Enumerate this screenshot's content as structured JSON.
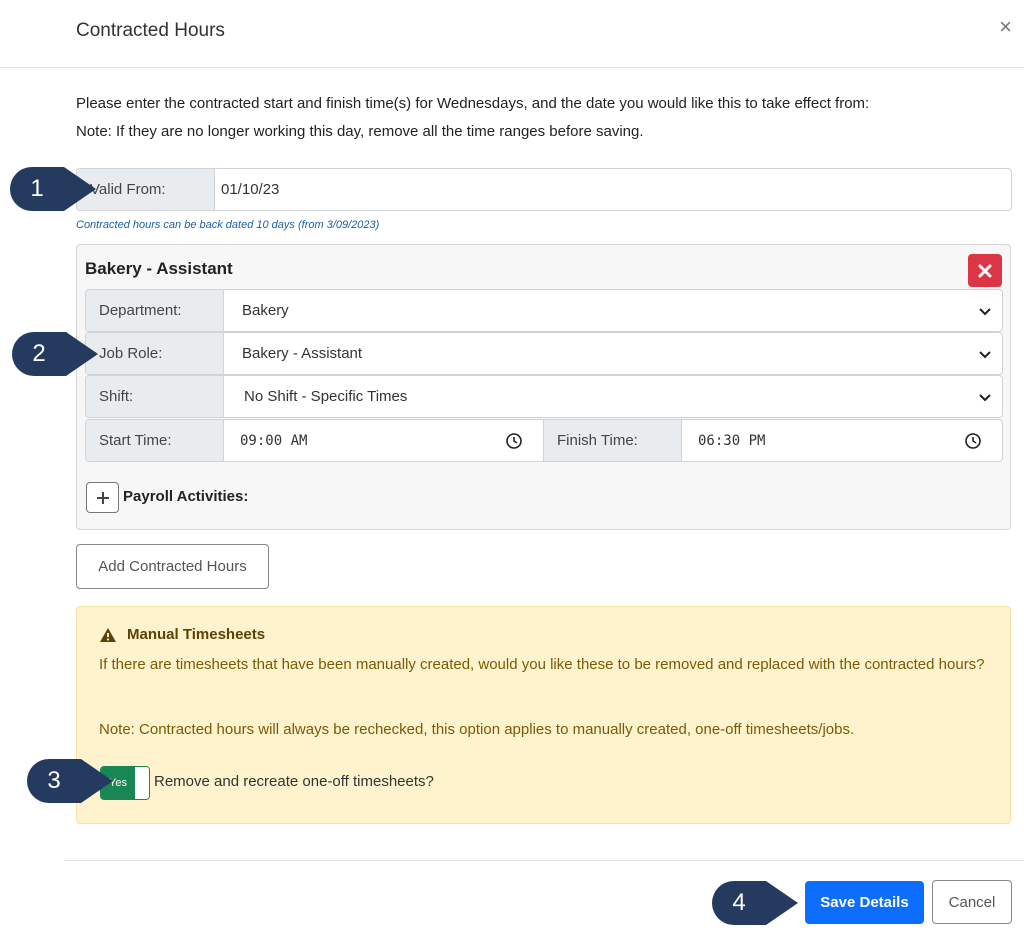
{
  "modal": {
    "title": "Contracted Hours",
    "close_glyph": "×"
  },
  "intro": {
    "line1": "Please enter the contracted start and finish time(s) for Wednesdays, and the date you would like this to take effect from:",
    "line2": "Note: If they are no longer working this day, remove all the time ranges before saving."
  },
  "valid_from": {
    "label": "Valid From:",
    "value": "01/10/23",
    "hint": "Contracted hours can be back dated 10 days (from 3/09/2023)"
  },
  "panel": {
    "title": "Bakery - Assistant",
    "delete_icon": "x-icon",
    "department": {
      "label": "Department:",
      "value": "Bakery"
    },
    "job_role": {
      "label": "Job Role:",
      "value": "Bakery - Assistant"
    },
    "shift": {
      "label": "Shift:",
      "value": "No Shift - Specific Times"
    },
    "start_time": {
      "label": "Start Time:",
      "value": "09:00 AM"
    },
    "finish_time": {
      "label": "Finish Time:",
      "value": "06:30 PM"
    },
    "payroll_label": "Payroll Activities:"
  },
  "add_button": "Add Contracted Hours",
  "alert": {
    "title": "Manual Timesheets",
    "body": "If there are timesheets that have been manually created, would you like these to be removed and replaced with the contracted hours?",
    "note": "Note: Contracted hours will always be rechecked, this option applies to manually created, one-off timesheets/jobs.",
    "toggle_text": "Yes",
    "toggle_label": "Remove and recreate one-off timesheets?"
  },
  "footer": {
    "save": "Save Details",
    "cancel": "Cancel"
  },
  "callouts": [
    "1",
    "2",
    "3",
    "4"
  ],
  "colors": {
    "callout": "#243a5e",
    "primary": "#0d6efd",
    "danger": "#dc3545",
    "success": "#198754",
    "warning_bg": "#fff3cd"
  }
}
